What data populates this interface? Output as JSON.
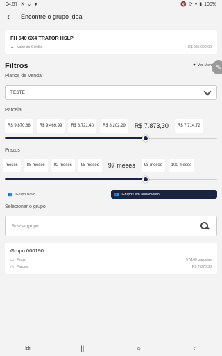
{
  "status_bar": {
    "time": "04:57",
    "icons_left": [
      "close-icon",
      "chevron-down-icon",
      "info-icon"
    ],
    "icons_right": [
      "mute-icon",
      "sync-icon",
      "wifi-icon",
      "battery-icon"
    ],
    "battery": "100%"
  },
  "header": {
    "title": "Encontre o grupo ideal"
  },
  "credit": {
    "title": "FH 540 6X4 TRATOR HSLP",
    "label": "Valor do Crédito",
    "value": "R$ 985.000,00"
  },
  "filters": {
    "title": "Filtros",
    "ver_menos": "Ver Menos",
    "planos_label": "Planos de Venda",
    "planos_value": "TESTE",
    "parcela_label": "Parcela",
    "parcelas": [
      "R$ 9.870,88",
      "R$ 9.469,99",
      "R$ 8.721,40",
      "R$ 8.202,29",
      "R$ 7.873,30",
      "R$ 7.714,72"
    ],
    "parcela_selected_index": 4,
    "parcela_slider_fraction": 0.662,
    "prazos_label": "Prazos",
    "prazos": [
      "meses",
      "88 meses",
      "92 meses",
      "95 meses",
      "97 meses",
      "98 meses",
      "100 meses"
    ],
    "prazo_selected_index": 4,
    "prazo_slider_fraction": 0.662,
    "toggle": {
      "left": "Grupo Novo",
      "right": "Grupos em andamento",
      "active": "right"
    }
  },
  "select_group": {
    "label": "Selecionar o grupo",
    "placeholder": "Buscar grupo"
  },
  "group": {
    "name": "Grupo 000190",
    "prazo_label": "Prazo",
    "prazo_value": "97/100 parcelas",
    "parcela_label": "Parcela",
    "parcela_value": "R$ 7.873,30"
  },
  "colors": {
    "accent": "#1a2340",
    "background": "#f3f3f3"
  }
}
